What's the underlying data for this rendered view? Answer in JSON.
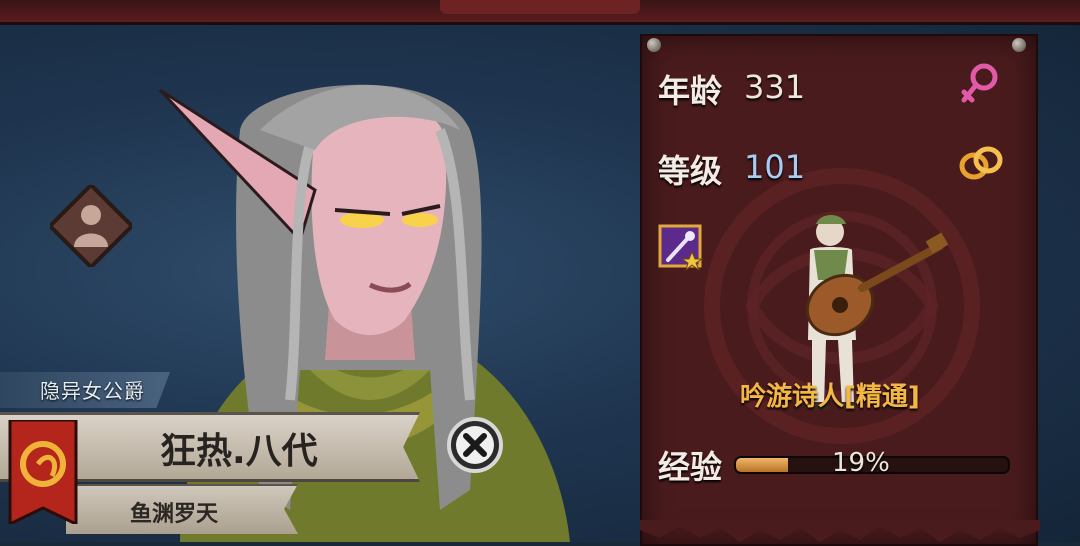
{
  "character": {
    "title": "隐异女公爵",
    "name": "狂热.八代",
    "house": "鱼渊罗天"
  },
  "stats": {
    "age_label": "年龄",
    "age_value": "331",
    "level_label": "等级",
    "level_value": "101",
    "class_name": "吟游诗人[精通]",
    "exp_label": "经验",
    "exp_percent_text": "19%",
    "exp_fraction": 0.19
  },
  "icons": {
    "gender": "female-symbol-icon",
    "marital": "wedding-rings-icon",
    "skill": "magic-staff-skill-icon",
    "rank": "hooded-figure-rank-icon",
    "close": "close-x-icon",
    "banner": "serpent-banner-icon"
  },
  "colors": {
    "panel": "#4a1b1d",
    "accent_gold": "#f3b744",
    "level_blue": "#a8cdf5",
    "gender_pink": "#e05aa8"
  }
}
